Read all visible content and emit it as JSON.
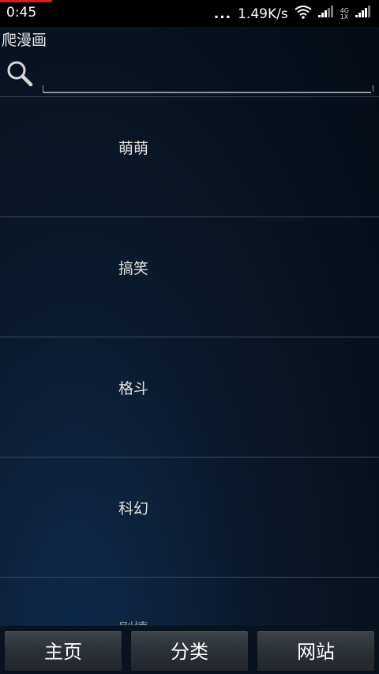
{
  "status_bar": {
    "time": "0:45",
    "dots": "...",
    "network_speed": "1.49K/s",
    "net_type_top": "4G",
    "net_type_bottom": "1X",
    "wifi_icon": "wifi-icon",
    "signal_icon": "signal-icon"
  },
  "app": {
    "title": "爬漫画"
  },
  "search": {
    "icon": "search-icon",
    "value": "",
    "placeholder": ""
  },
  "categories": [
    {
      "label": "萌萌"
    },
    {
      "label": "搞笑"
    },
    {
      "label": "格斗"
    },
    {
      "label": "科幻"
    },
    {
      "label": "剧情"
    }
  ],
  "bottom_nav": {
    "home": "主页",
    "category": "分类",
    "sites": "网站"
  },
  "colors": {
    "status_progress": "#e01818",
    "background": "#07101c",
    "divider": "#3a4656"
  }
}
